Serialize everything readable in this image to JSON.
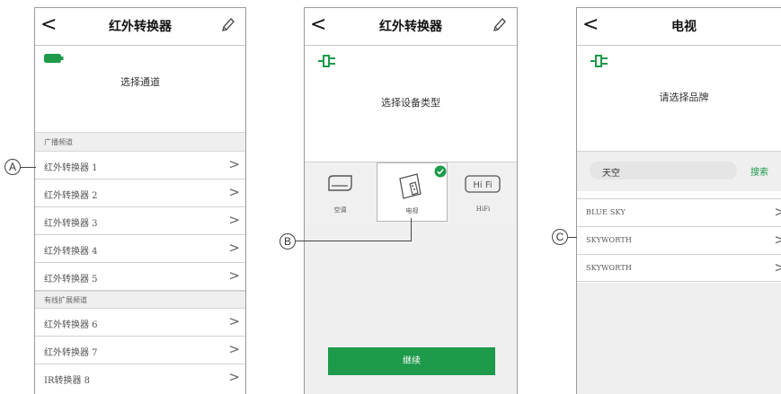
{
  "colors": {
    "accent": "#1d9a4a",
    "battery": "#1d9a4a"
  },
  "screen1": {
    "title": "红外转换器",
    "back_icon": "back-chevron-icon",
    "edit_icon": "pencil-icon",
    "battery_icon": "battery-icon",
    "prompt": "选择通道",
    "section_broadcast": "广播频道",
    "broadcast_channels": [
      "红外转换器 1",
      "红外转换器 2",
      "红外转换器 3",
      "红外转换器 4",
      "红外转换器 5"
    ],
    "section_wired": "有线扩展频道",
    "wired_channels": [
      "红外转换器 6",
      "红外转换器 7",
      "IR转换器 8"
    ],
    "callout": "A"
  },
  "screen2": {
    "title": "红外转换器",
    "plug_icon": "plug-icon",
    "prompt": "选择设备类型",
    "devices": [
      {
        "label": "空调",
        "icon": "air-conditioner-icon",
        "selected": false
      },
      {
        "label": "电视",
        "icon": "tv-remote-icon",
        "selected": true
      },
      {
        "label": "HiFi",
        "icon": "hifi-icon",
        "selected": false
      }
    ],
    "continue": "继续",
    "callout": "B"
  },
  "screen3": {
    "title": "电视",
    "plug_icon": "plug-icon",
    "prompt": "请选择品牌",
    "search_value": "天空",
    "search_button": "搜索",
    "brands": [
      "BLUE SKY",
      "SKYWORTH",
      "SKYWORTH"
    ],
    "callout": "C"
  }
}
